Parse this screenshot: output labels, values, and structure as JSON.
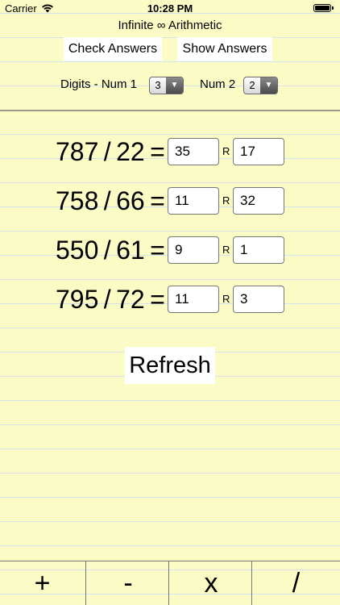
{
  "status_bar": {
    "carrier": "Carrier",
    "time": "10:28 PM"
  },
  "app": {
    "title": "Infinite ∞ Arithmetic"
  },
  "toolbar": {
    "check_label": "Check Answers",
    "show_label": "Show Answers"
  },
  "digits": {
    "num1_label": "Digits - Num 1",
    "num1_value": "3",
    "num2_label": "Num 2",
    "num2_value": "2"
  },
  "problems": [
    {
      "expression": "787 / 22 =",
      "quotient": "35",
      "remainder": "17"
    },
    {
      "expression": "758 / 66 =",
      "quotient": "11",
      "remainder": "32"
    },
    {
      "expression": "550 / 61 =",
      "quotient": "9",
      "remainder": "1"
    },
    {
      "expression": "795 / 72 =",
      "quotient": "11",
      "remainder": "3"
    }
  ],
  "remainder_label": "R",
  "refresh_label": "Refresh",
  "operations": [
    "+",
    "-",
    "x",
    "/"
  ],
  "colors": {
    "paper": "#fbfbc6",
    "rule_line": "#d9e1ea",
    "divider": "#9a9a8c"
  }
}
